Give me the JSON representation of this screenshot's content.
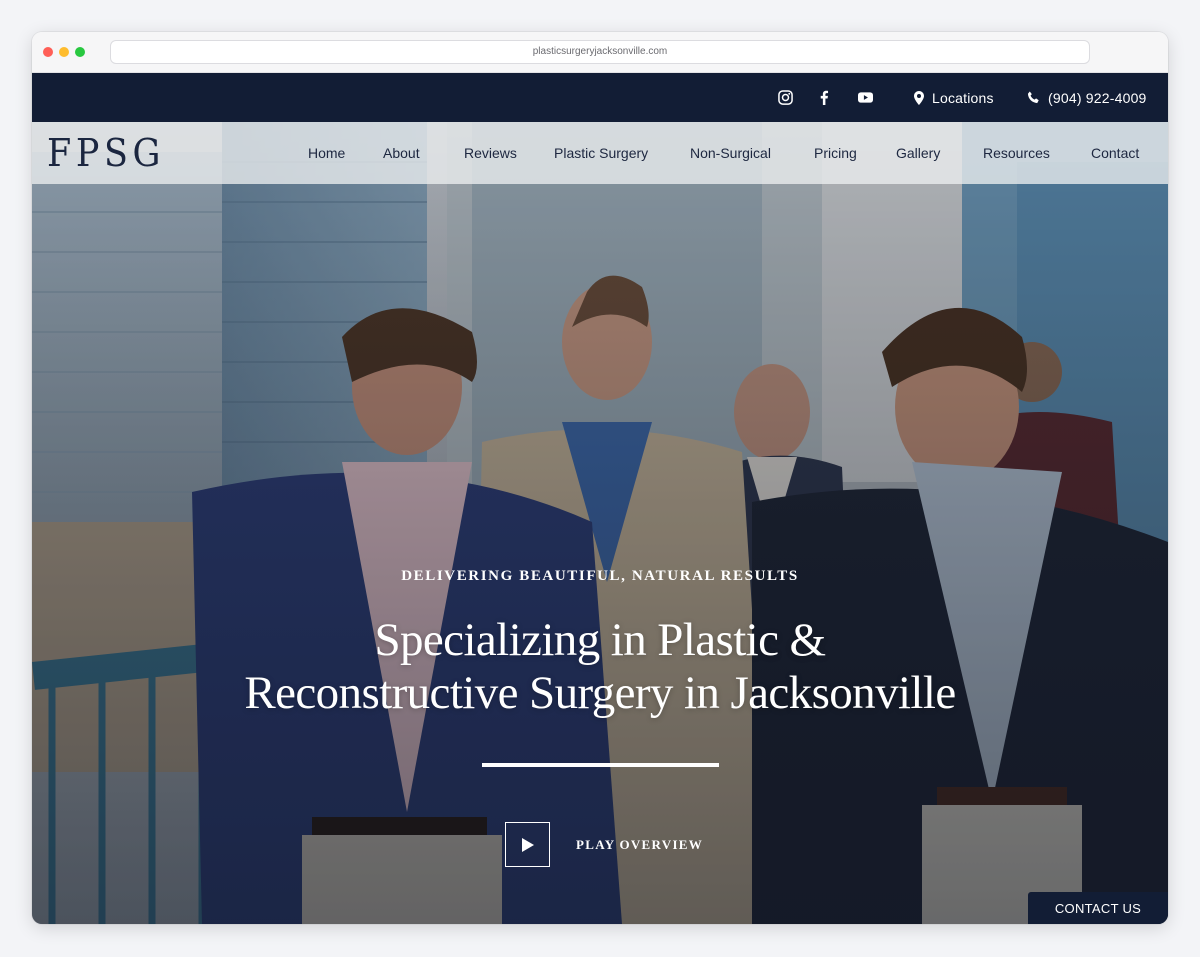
{
  "browser": {
    "url": "plasticsurgeryjacksonville.com"
  },
  "topbar": {
    "social": [
      {
        "icon": "instagram-icon"
      },
      {
        "icon": "facebook-icon"
      },
      {
        "icon": "youtube-icon"
      }
    ],
    "locations_label": "Locations",
    "phone": "(904) 922-4009"
  },
  "nav": {
    "logo": "FPSG",
    "items": [
      "Home",
      "About",
      "Reviews",
      "Plastic Surgery",
      "Non-Surgical",
      "Pricing",
      "Gallery",
      "Resources",
      "Contact"
    ]
  },
  "hero": {
    "eyebrow": "DELIVERING BEAUTIFUL, NATURAL RESULTS",
    "headline_line1": "Specializing in Plastic &",
    "headline_line2": "Reconstructive Surgery in Jacksonville",
    "play_label": "PLAY OVERVIEW"
  },
  "contact_button": "CONTACT US",
  "colors": {
    "navy": "#121d35",
    "nav_text": "#1d2740",
    "white": "#ffffff"
  }
}
